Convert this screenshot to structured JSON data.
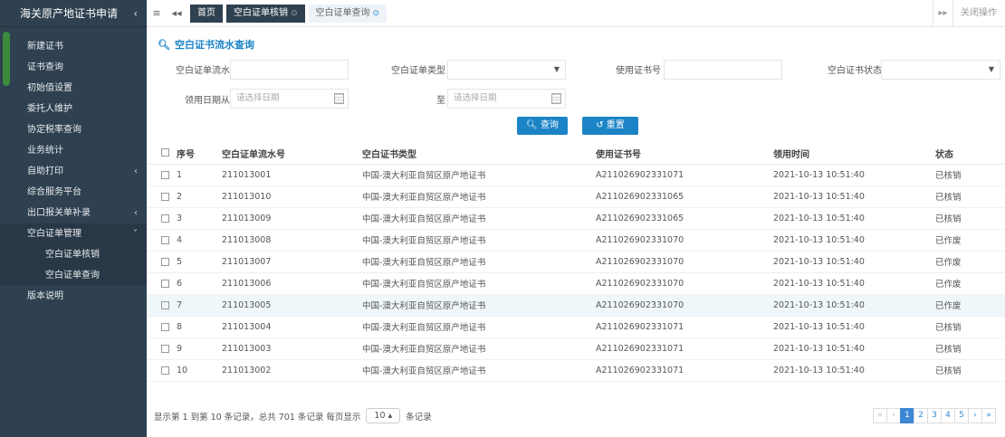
{
  "app": {
    "title": "海关原产地证书申请",
    "collapse_arrow": "‹"
  },
  "sidebar": {
    "items": [
      {
        "label": "新建证书"
      },
      {
        "label": "证书查询"
      },
      {
        "label": "初始值设置"
      },
      {
        "label": "委托人维护"
      },
      {
        "label": "协定税率查询"
      },
      {
        "label": "业务统计"
      },
      {
        "label": "自助打印",
        "caret": "‹"
      },
      {
        "label": "综合服务平台"
      },
      {
        "label": "出口报关单补录",
        "caret": "‹"
      },
      {
        "label": "空白证单管理",
        "caret": "˅"
      },
      {
        "label": "版本说明"
      }
    ],
    "sub_items": [
      {
        "label": "空白证单核销"
      },
      {
        "label": "空白证单查询"
      }
    ]
  },
  "topbar": {
    "menu_icon": "≡",
    "back_icon": "◂◂",
    "tabs": [
      {
        "label": "首页"
      },
      {
        "label": "空白证单核销",
        "dot": "⊙"
      },
      {
        "label": "空白证单查询",
        "dot": "⊙"
      }
    ],
    "forward_icon": "▸▸",
    "close_ops": "关闭操作"
  },
  "search": {
    "title": "空白证书流水查询",
    "fields": {
      "serial_label": "空白证单流水号",
      "type_label": "空白证单类型",
      "cert_no_label": "使用证书号",
      "status_label": "空白证书状态",
      "date_from_label": "领用日期从",
      "date_to_label": "至",
      "date_placeholder": "请选择日期"
    },
    "query_button": "查询",
    "reset_button": "重置"
  },
  "table": {
    "headers": [
      "序号",
      "空白证单流水号",
      "空白证书类型",
      "使用证书号",
      "领用时间",
      "状态"
    ],
    "rows": [
      {
        "no": "1",
        "serial": "211013001",
        "type": "中国-澳大利亚自贸区原产地证书",
        "cert": "A211026902331071",
        "time": "2021-10-13 10:51:40",
        "status": "已核销"
      },
      {
        "no": "2",
        "serial": "211013010",
        "type": "中国-澳大利亚自贸区原产地证书",
        "cert": "A211026902331065",
        "time": "2021-10-13 10:51:40",
        "status": "已核销"
      },
      {
        "no": "3",
        "serial": "211013009",
        "type": "中国-澳大利亚自贸区原产地证书",
        "cert": "A211026902331065",
        "time": "2021-10-13 10:51:40",
        "status": "已核销"
      },
      {
        "no": "4",
        "serial": "211013008",
        "type": "中国-澳大利亚自贸区原产地证书",
        "cert": "A211026902331070",
        "time": "2021-10-13 10:51:40",
        "status": "已作废"
      },
      {
        "no": "5",
        "serial": "211013007",
        "type": "中国-澳大利亚自贸区原产地证书",
        "cert": "A211026902331070",
        "time": "2021-10-13 10:51:40",
        "status": "已作废"
      },
      {
        "no": "6",
        "serial": "211013006",
        "type": "中国-澳大利亚自贸区原产地证书",
        "cert": "A211026902331070",
        "time": "2021-10-13 10:51:40",
        "status": "已作废"
      },
      {
        "no": "7",
        "serial": "211013005",
        "type": "中国-澳大利亚自贸区原产地证书",
        "cert": "A211026902331070",
        "time": "2021-10-13 10:51:40",
        "status": "已作废"
      },
      {
        "no": "8",
        "serial": "211013004",
        "type": "中国-澳大利亚自贸区原产地证书",
        "cert": "A211026902331071",
        "time": "2021-10-13 10:51:40",
        "status": "已核销"
      },
      {
        "no": "9",
        "serial": "211013003",
        "type": "中国-澳大利亚自贸区原产地证书",
        "cert": "A211026902331071",
        "time": "2021-10-13 10:51:40",
        "status": "已核销"
      },
      {
        "no": "10",
        "serial": "211013002",
        "type": "中国-澳大利亚自贸区原产地证书",
        "cert": "A211026902331071",
        "time": "2021-10-13 10:51:40",
        "status": "已核销"
      }
    ]
  },
  "footer": {
    "summary": "显示第 1 到第 10 条记录，总共 701 条记录 每页显示",
    "page_size": "10 ▴",
    "suffix": "条记录"
  },
  "pager": {
    "first": "«",
    "prev": "‹",
    "pages": [
      "1",
      "2",
      "3",
      "4",
      "5"
    ],
    "next": "›",
    "last": "»"
  }
}
